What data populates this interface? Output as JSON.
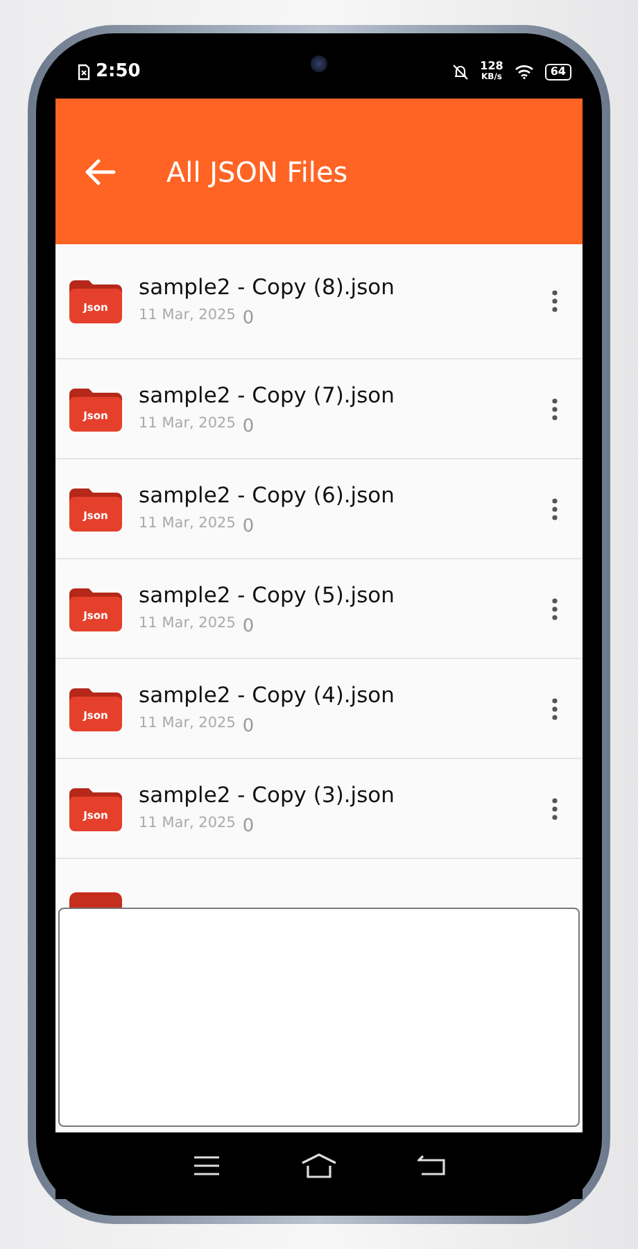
{
  "status_bar": {
    "time": "2:50",
    "speed_value": "128",
    "speed_unit": "KB/s",
    "battery": "64"
  },
  "header": {
    "title": "All JSON Files"
  },
  "files": [
    {
      "name": "sample2 - Copy (8).json",
      "date": "11 Mar, 2025",
      "size": "0",
      "icon_label": "Json"
    },
    {
      "name": "sample2 - Copy (7).json",
      "date": "11 Mar, 2025",
      "size": "0",
      "icon_label": "Json"
    },
    {
      "name": "sample2 - Copy (6).json",
      "date": "11 Mar, 2025",
      "size": "0",
      "icon_label": "Json"
    },
    {
      "name": "sample2 - Copy (5).json",
      "date": "11 Mar, 2025",
      "size": "0",
      "icon_label": "Json"
    },
    {
      "name": "sample2 - Copy (4).json",
      "date": "11 Mar, 2025",
      "size": "0",
      "icon_label": "Json"
    },
    {
      "name": "sample2 - Copy (3).json",
      "date": "11 Mar, 2025",
      "size": "0",
      "icon_label": "Json"
    }
  ]
}
